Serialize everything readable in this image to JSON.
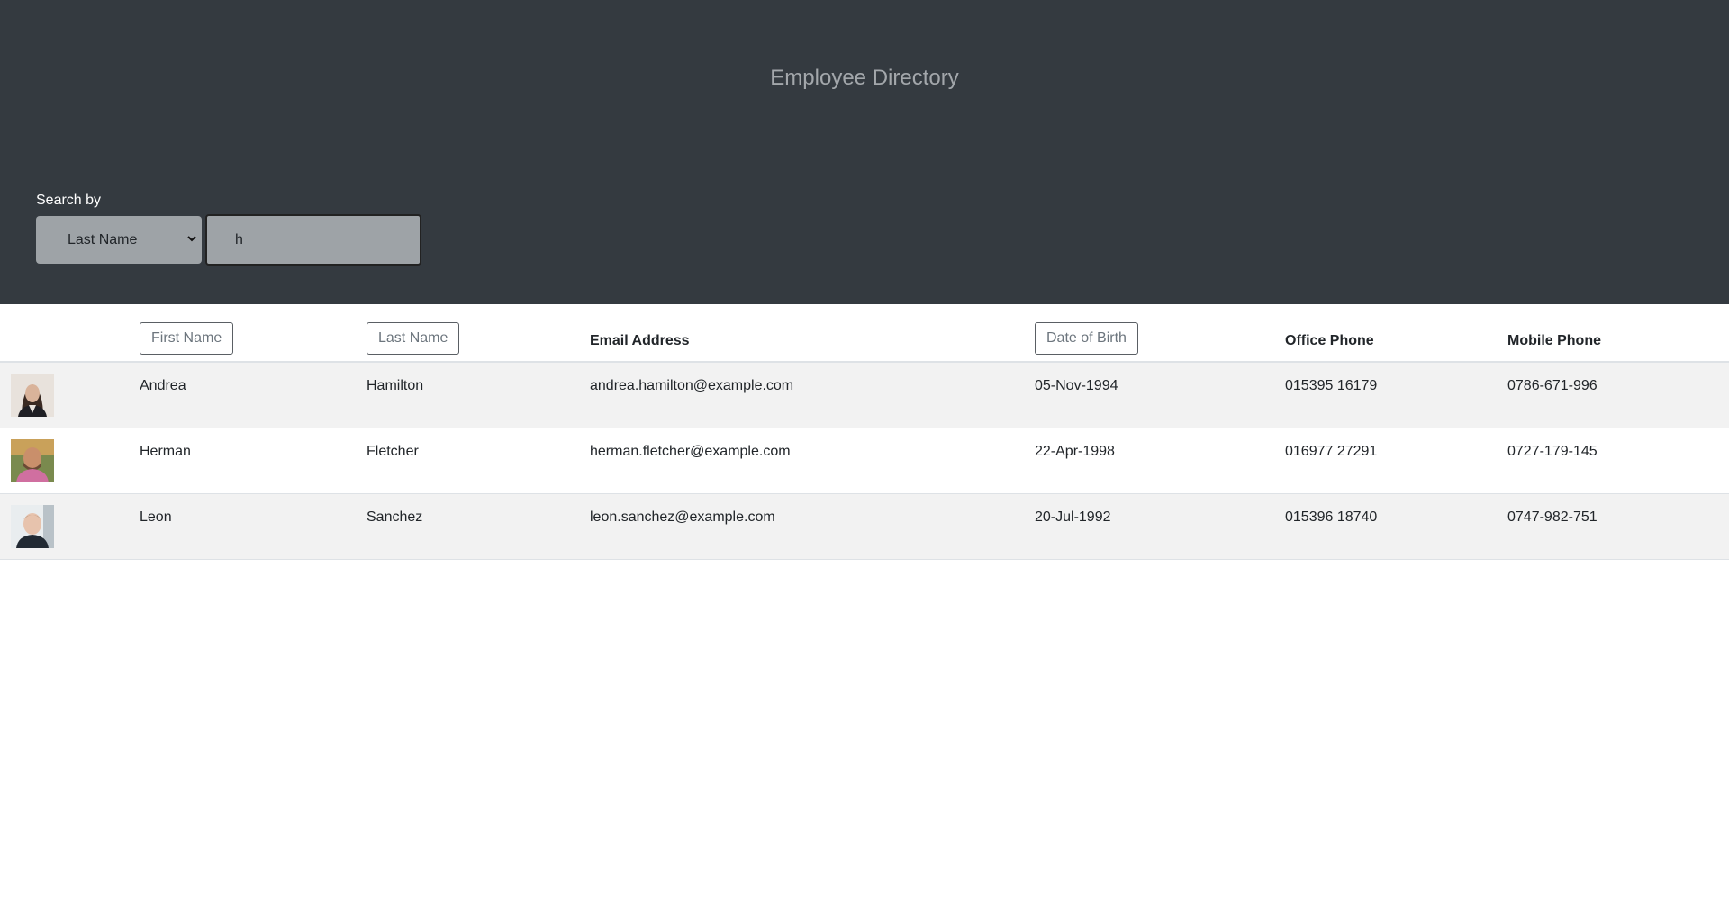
{
  "header": {
    "title": "Employee Directory",
    "search_label": "Search by",
    "search_select_value": "Last Name",
    "search_input_value": "h"
  },
  "table": {
    "columns": {
      "first_name": "First Name",
      "last_name": "Last Name",
      "email": "Email Address",
      "dob": "Date of Birth",
      "office_phone": "Office Phone",
      "mobile_phone": "Mobile Phone"
    },
    "rows": [
      {
        "first": "Andrea",
        "last": "Hamilton",
        "email": "andrea.hamilton@example.com",
        "dob": "05-Nov-1994",
        "office": "015395 16179",
        "mobile": "0786-671-996"
      },
      {
        "first": "Herman",
        "last": "Fletcher",
        "email": "herman.fletcher@example.com",
        "dob": "22-Apr-1998",
        "office": "016977 27291",
        "mobile": "0727-179-145"
      },
      {
        "first": "Leon",
        "last": "Sanchez",
        "email": "leon.sanchez@example.com",
        "dob": "20-Jul-1992",
        "office": "015396 18740",
        "mobile": "0747-982-751"
      }
    ]
  },
  "colors": {
    "header_bg": "#343a40",
    "title": "#a3a7ab",
    "search_control_bg": "#9ea3a7",
    "row_stripe": "#f2f2f2"
  },
  "icons": [
    "chevron-down-icon",
    "avatar"
  ]
}
